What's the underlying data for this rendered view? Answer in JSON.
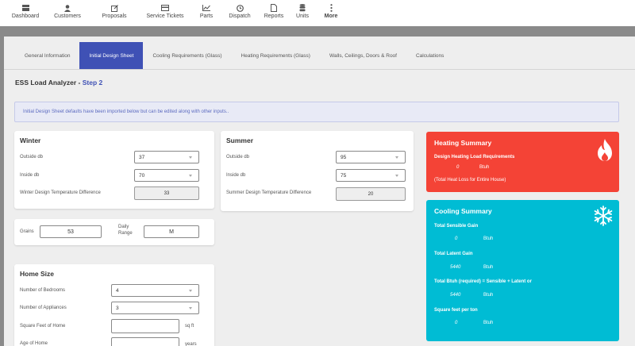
{
  "nav": {
    "items": [
      {
        "label": "Dashboard",
        "icon": "dashboard-icon"
      },
      {
        "label": "Customers",
        "icon": "person-icon"
      },
      {
        "label": "Proposals",
        "icon": "edit-icon"
      },
      {
        "label": "Service Tickets",
        "icon": "card-icon"
      },
      {
        "label": "Parts",
        "icon": "chart-icon"
      },
      {
        "label": "Dispatch",
        "icon": "clock-icon"
      },
      {
        "label": "Reports",
        "icon": "document-icon"
      },
      {
        "label": "Units",
        "icon": "database-icon"
      },
      {
        "label": "More",
        "icon": "more-vertical-icon"
      }
    ]
  },
  "tabs": [
    {
      "label": "General Information",
      "active": false
    },
    {
      "label": "Initial Design Sheet",
      "active": true
    },
    {
      "label": "Cooling Requirements (Glass)",
      "active": false
    },
    {
      "label": "Heating Requirements (Glass)",
      "active": false
    },
    {
      "label": "Walls, Ceilings, Doors & Roof",
      "active": false
    },
    {
      "label": "Calculations",
      "active": false
    }
  ],
  "page": {
    "title": "ESS Load Analyzer - ",
    "step": "Step 2",
    "info": "Initial Design Sheet defaults have been imported below but can be edited along with other inputs.."
  },
  "winter": {
    "title": "Winter",
    "outside_label": "Outside db",
    "outside_value": "37",
    "inside_label": "Inside db",
    "inside_value": "70",
    "diff_label": "Winter Design Temperature Difference",
    "diff_value": "33"
  },
  "summer": {
    "title": "Summer",
    "outside_label": "Outside db",
    "outside_value": "95",
    "inside_label": "Inside db",
    "inside_value": "75",
    "diff_label": "Summer Design Temperature Difference",
    "diff_value": "20"
  },
  "grains": {
    "grains_label": "Grains",
    "grains_value": "53",
    "range_label_1": "Daily",
    "range_label_2": "Range",
    "range_value": "M"
  },
  "home": {
    "title": "Home Size",
    "bedrooms_label": "Number of Bedrooms",
    "bedrooms_value": "4",
    "appliances_label": "Number of Appliances",
    "appliances_value": "3",
    "sqft_label": "Square Feet of Home",
    "sqft_unit": "sq ft",
    "age_label": "Age of Home",
    "age_unit": "years"
  },
  "heating": {
    "title": "Heating Summary",
    "req_label": "Design Heating Load Requirements",
    "req_value": "0",
    "req_unit": "Btuh",
    "note": "(Total Heat Loss for Entire House)",
    "color": "#f44336"
  },
  "cooling": {
    "title": "Cooling Summary",
    "sensible_label": "Total Sensible Gain",
    "sensible_value": "0",
    "latent_label": "Total Latent Gain",
    "latent_value": "5440",
    "total_label": "Total Btuh (required) = Sensible + Latent or",
    "total_value": "5440",
    "sqft_label": "Square feet per ton",
    "sqft_value": "0",
    "unit": "Btuh",
    "color": "#00bcd4"
  }
}
